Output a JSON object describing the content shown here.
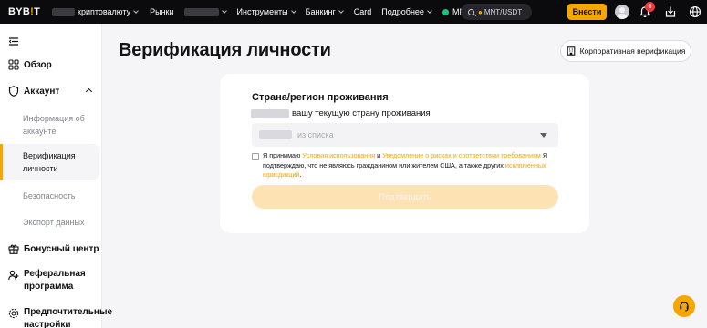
{
  "topbar": {
    "logo_left": "BYB",
    "logo_mid": "!",
    "logo_right": "T",
    "nav_crypto": "криптовалюту",
    "nav_markets": "Рынки",
    "nav_tools": "Инструменты",
    "nav_banking": "Банкинг",
    "nav_card": "Card",
    "nav_more": "Подробнее",
    "nav_mnt": "MNT",
    "search_text": "MNT/USDT",
    "deposit_label": "Внести",
    "notification_count": "6"
  },
  "sidebar": {
    "overview": "Обзор",
    "account": "Аккаунт",
    "account_info": "Информация об аккаунте",
    "identity_verification": "Верификация личности",
    "security": "Безопасность",
    "data_export": "Экспорт данных",
    "bonus_center": "Бонусный центр",
    "referral": "Реферальная программа",
    "preferences": "Предпочтительные настройки"
  },
  "main": {
    "title": "Верификация личности",
    "corporate_button": "Корпоративная верификация",
    "card_heading": "Страна/регион проживания",
    "card_sub": "вашу текущую страну проживания",
    "select_placeholder": "из списка",
    "agree_prefix": "Я принимаю ",
    "terms_link": "Условия использования",
    "and": " и ",
    "risk_link": "Уведомление о рисках и соответствии требованиям",
    "agree_middle": " Я подтверждаю, что не являюсь гражданином или жителем США, а также других ",
    "excluded_link": "исключенных юрисдикций",
    "agree_end": ".",
    "submit_label": "Подтвердить"
  },
  "colors": {
    "accent": "#f7a600",
    "topbar_bg": "#0b0b0e",
    "page_bg": "#f5f5f7",
    "submit_disabled": "#fde3b3",
    "badge": "#f03a3a"
  },
  "icons": [
    "menu-icon",
    "overview-icon",
    "shield-icon",
    "gift-icon",
    "referral-icon",
    "settings-icon",
    "search-icon",
    "bell-icon",
    "download-icon",
    "globe-icon",
    "building-icon",
    "headset-icon",
    "chevron-down-icon",
    "chevron-up-icon"
  ]
}
